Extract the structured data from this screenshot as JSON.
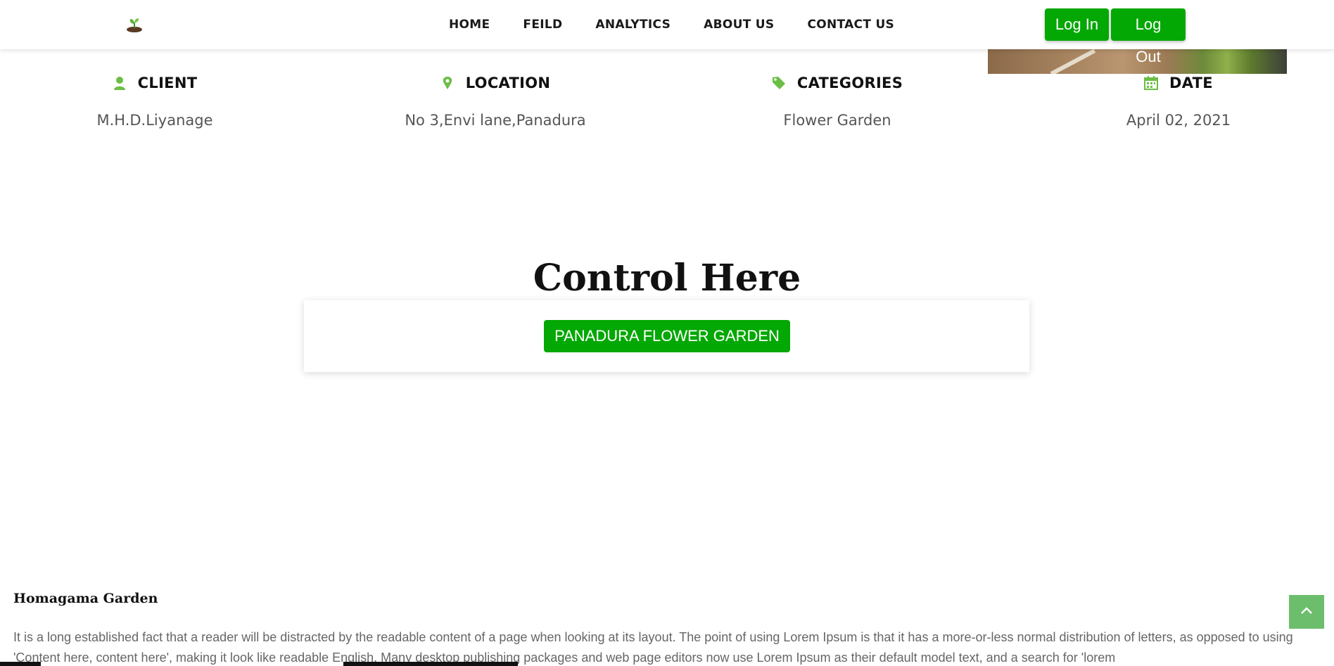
{
  "header": {
    "logo_icon": "seedling-icon",
    "nav": [
      {
        "label": "HOME"
      },
      {
        "label": "FEILD"
      },
      {
        "label": "ANALYTICS"
      },
      {
        "label": "ABOUT US"
      },
      {
        "label": "CONTACT US"
      }
    ],
    "login_label": "Log In",
    "logout_label": "Log Out"
  },
  "info": [
    {
      "icon": "user-icon",
      "label": "CLIENT",
      "value": "M.H.D.Liyanage"
    },
    {
      "icon": "map-pin-icon",
      "label": "LOCATION",
      "value": "No 3,Envi lane,Panadura"
    },
    {
      "icon": "tag-icon",
      "label": "CATEGORIES",
      "value": "Flower Garden"
    },
    {
      "icon": "calendar-icon",
      "label": "DATE",
      "value": "April 02, 2021"
    }
  ],
  "control": {
    "title": "Control Here",
    "garden_button": "PANADURA FLOWER GARDEN"
  },
  "garden": {
    "name": "Homagama Garden",
    "description": "It is a long established fact that a reader will be distracted by the readable content of a page when looking at its layout. The point of using Lorem Ipsum is that it has a more-or-less normal distribution of letters, as opposed to using 'Content here, content here', making it look like readable English. Many desktop publishing packages and web page editors now use Lorem Ipsum as their default model text, and a search for 'lorem"
  },
  "colors": {
    "accent_green": "#04a804",
    "icon_green": "#6cbe45",
    "to_top_bg": "#6cbe6c"
  },
  "back_to_top_icon": "chevron-up-icon"
}
